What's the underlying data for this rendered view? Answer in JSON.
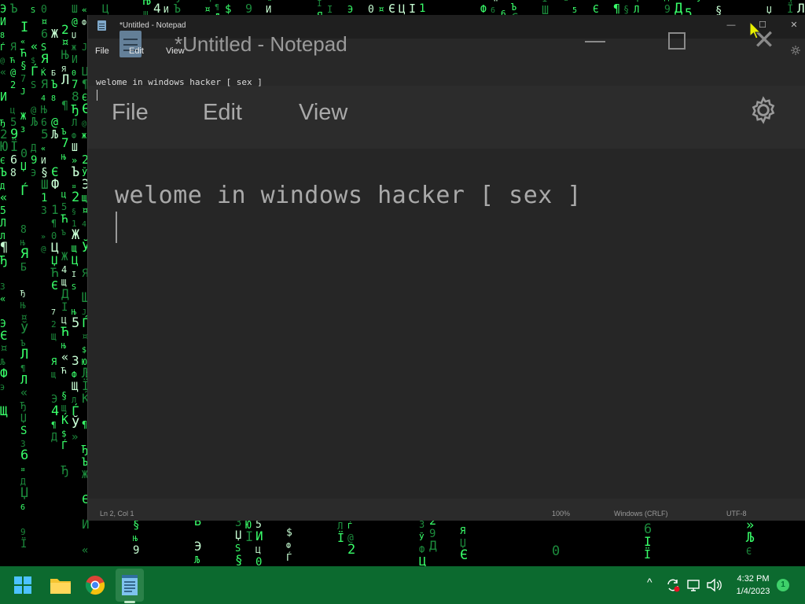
{
  "window": {
    "title": "*Untitled - Notepad",
    "minimize": "—",
    "maximize": "☐",
    "close": "✕"
  },
  "menu": {
    "file": "File",
    "edit": "Edit",
    "view": "View"
  },
  "editor": {
    "text": "welome in windows hacker [ sex ]"
  },
  "ghost": {
    "title": "*Untitled - Notepad",
    "file": "File",
    "edit": "Edit",
    "view": "View",
    "text": "welome in windows hacker [ sex ]"
  },
  "statusbar": {
    "position": "Ln 2, Col 1",
    "zoom": "100%",
    "line_ending": "Windows (CRLF)",
    "encoding": "UTF-8"
  },
  "taskbar": {
    "time": "4:32 PM",
    "date": "1/4/2023",
    "notification_count": "1",
    "apps": [
      "start-icon",
      "file-explorer-icon",
      "chrome-icon",
      "notepad-icon"
    ],
    "tray_icons": [
      "chevron-up-icon",
      "sync-icon",
      "network-icon",
      "volume-icon"
    ]
  },
  "colors": {
    "taskbar": "#0c6a2f",
    "window_bg": "#282828",
    "matrix_green": "#39ff6a"
  }
}
